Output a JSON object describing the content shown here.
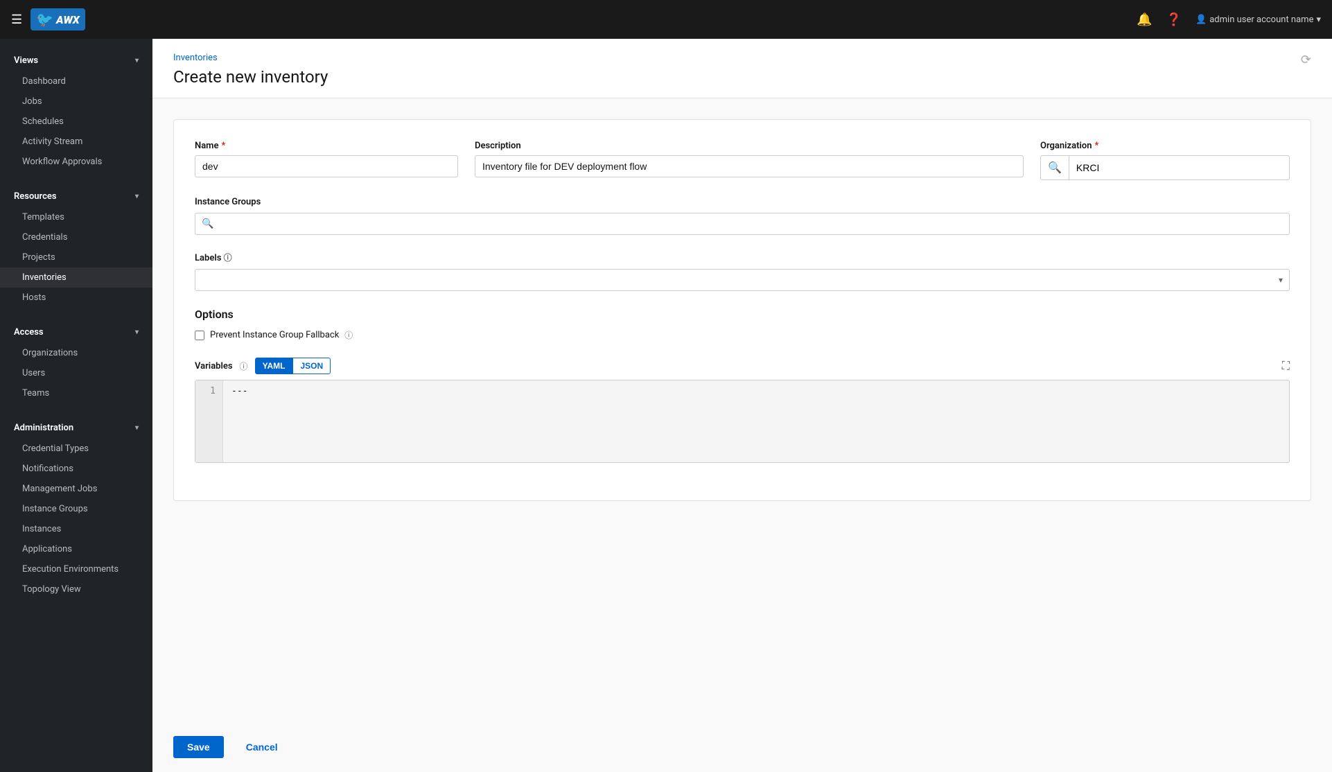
{
  "navbar": {
    "app_name": "AWX",
    "logo_text": "AWX",
    "notification_icon": "🔔",
    "help_icon": "?",
    "user_name": "admin user account name",
    "chevron": "▾"
  },
  "sidebar": {
    "views_section": "Views",
    "views_items": [
      {
        "label": "Dashboard",
        "id": "dashboard"
      },
      {
        "label": "Jobs",
        "id": "jobs"
      },
      {
        "label": "Schedules",
        "id": "schedules"
      },
      {
        "label": "Activity Stream",
        "id": "activity-stream"
      },
      {
        "label": "Workflow Approvals",
        "id": "workflow-approvals"
      }
    ],
    "resources_section": "Resources",
    "resources_items": [
      {
        "label": "Templates",
        "id": "templates"
      },
      {
        "label": "Credentials",
        "id": "credentials"
      },
      {
        "label": "Projects",
        "id": "projects"
      },
      {
        "label": "Inventories",
        "id": "inventories",
        "active": true
      },
      {
        "label": "Hosts",
        "id": "hosts"
      }
    ],
    "access_section": "Access",
    "access_items": [
      {
        "label": "Organizations",
        "id": "organizations"
      },
      {
        "label": "Users",
        "id": "users"
      },
      {
        "label": "Teams",
        "id": "teams"
      }
    ],
    "administration_section": "Administration",
    "administration_items": [
      {
        "label": "Credential Types",
        "id": "credential-types"
      },
      {
        "label": "Notifications",
        "id": "notifications"
      },
      {
        "label": "Management Jobs",
        "id": "management-jobs"
      },
      {
        "label": "Instance Groups",
        "id": "instance-groups"
      },
      {
        "label": "Instances",
        "id": "instances"
      },
      {
        "label": "Applications",
        "id": "applications"
      },
      {
        "label": "Execution Environments",
        "id": "execution-environments"
      },
      {
        "label": "Topology View",
        "id": "topology-view"
      }
    ]
  },
  "page": {
    "breadcrumb": "Inventories",
    "title": "Create new inventory",
    "history_icon": "⟳"
  },
  "form": {
    "name_label": "Name",
    "name_required": "*",
    "name_value": "dev",
    "description_label": "Description",
    "description_value": "Inventory file for DEV deployment flow",
    "organization_label": "Organization",
    "organization_required": "*",
    "organization_value": "KRCI",
    "instance_groups_label": "Instance Groups",
    "labels_label": "Labels",
    "options_title": "Options",
    "prevent_fallback_label": "Prevent Instance Group Fallback",
    "prevent_fallback_checked": false,
    "variables_label": "Variables",
    "yaml_tab": "YAML",
    "json_tab": "JSON",
    "active_tab": "yaml",
    "code_line": "1",
    "code_content": "---",
    "save_button": "Save",
    "cancel_button": "Cancel"
  }
}
